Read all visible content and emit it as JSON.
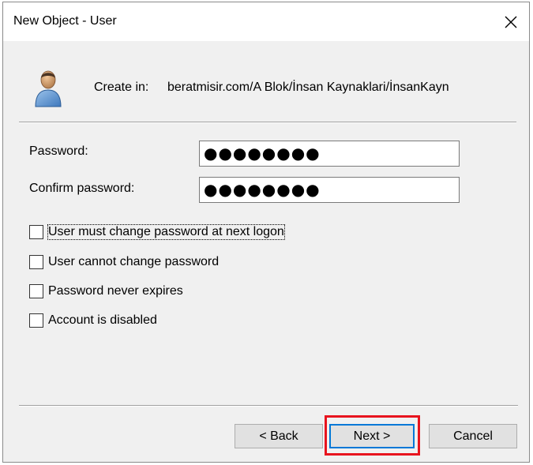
{
  "window": {
    "title": "New Object - User"
  },
  "header": {
    "create_in_label": "Create in:",
    "create_in_path": "beratmisir.com/A Blok/İnsan Kaynaklari/İnsanKayn"
  },
  "fields": {
    "password_label": "Password:",
    "password_value": "●●●●●●●●",
    "confirm_label": "Confirm password:",
    "confirm_value": "●●●●●●●●"
  },
  "options": [
    {
      "label": "User must change password at next logon",
      "checked": false
    },
    {
      "label": "User cannot change password",
      "checked": false
    },
    {
      "label": "Password never expires",
      "checked": false
    },
    {
      "label": "Account is disabled",
      "checked": false
    }
  ],
  "buttons": {
    "back": "< Back",
    "next": "Next >",
    "cancel": "Cancel"
  },
  "colors": {
    "highlight": "#e8141e",
    "focus_border": "#0078d7",
    "dialog_bg": "#f0f0f0"
  },
  "icons": {
    "user": "user-icon",
    "close": "close-icon"
  }
}
